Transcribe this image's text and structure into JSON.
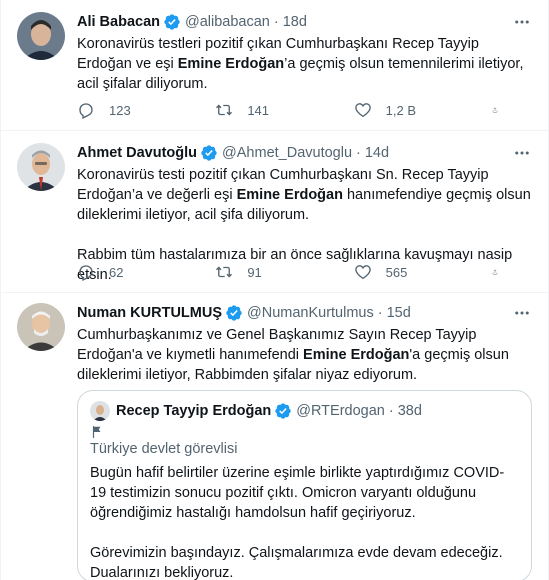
{
  "tweets": [
    {
      "name": "Ali Babacan",
      "handle": "@alibabacan",
      "time": "18d",
      "text_parts": [
        "Koronavirüs testleri pozitif çıkan Cumhurbaşkanı Recep Tayyip Erdoğan ve eşi ",
        "Emine Erdoğan",
        "’a geçmiş olsun temennilerimi iletiyor, acil şifalar diliyorum."
      ],
      "replies": "123",
      "retweets": "141",
      "likes": "1,2 B"
    },
    {
      "name": "Ahmet Davutoğlu",
      "handle": "@Ahmet_Davutoglu",
      "time": "14d",
      "text_parts": [
        "Koronavirüs testi pozitif çıkan Cumhurbaşkanı Sn. Recep Tayyip Erdoğan’a ve değerli eşi ",
        "Emine Erdoğan",
        " hanımefendiye geçmiş olsun dileklerimi iletiyor, acil şifa diliyorum.\n\nRabbim tüm hastalarımıza bir an önce sağlıklarına kavuşmayı nasip etsin."
      ],
      "replies": "62",
      "retweets": "91",
      "likes": "565"
    },
    {
      "name": "Numan KURTULMUŞ",
      "handle": "@NumanKurtulmus",
      "time": "15d",
      "text_parts": [
        "Cumhurbaşkanımız ve Genel Başkanımız Sayın Recep Tayyip Erdoğan'a ve kıymetli hanımefendi ",
        "Emine Erdoğan",
        "'a geçmiş olsun dileklerimi iletiyor, Rabbimden şifalar niyaz ediyorum."
      ]
    }
  ],
  "quote": {
    "name": "Recep Tayyip Erdoğan",
    "handle": "@RTErdogan",
    "time": "38d",
    "label": "Türkiye devlet görevlisi",
    "text": "Bugün hafif belirtiler üzerine eşimle birlikte yaptırdığımız COVID-19 testimizin sonucu pozitif çıktı. Omicron varyantı olduğunu öğrendiğimiz hastalığı hamdolsun hafif geçiriyoruz.\n\nGörevimizin başındayız. Çalışmalarımıza evde devam edeceğiz. Dualarınızı bekliyoruz."
  },
  "dot": "·",
  "icons": [
    "verified-badge-icon",
    "more-icon",
    "reply-icon",
    "retweet-icon",
    "like-icon",
    "share-icon",
    "flag-icon"
  ],
  "colors": {
    "verified": "#1d9bf0",
    "secondary": "#536471",
    "divider": "#eff3f4",
    "border": "#cfd9de"
  }
}
